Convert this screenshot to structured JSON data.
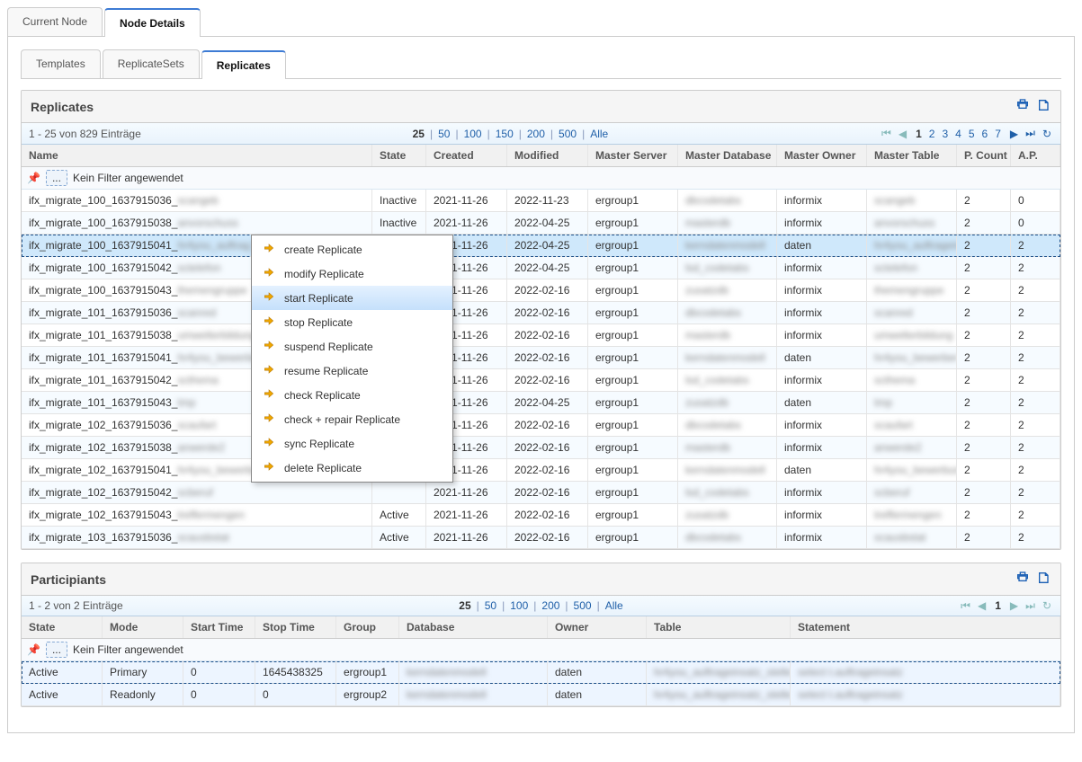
{
  "top_tabs": [
    "Current Node",
    "Node Details"
  ],
  "top_tab_active": 1,
  "inner_tabs": [
    "Templates",
    "ReplicateSets",
    "Replicates"
  ],
  "inner_tab_active": 2,
  "replicates_panel": {
    "title": "Replicates",
    "entries_label": "1 - 25 von 829 Einträge",
    "page_sizes": [
      "25",
      "50",
      "100",
      "150",
      "200",
      "500",
      "Alle"
    ],
    "page_size_current": "25",
    "pages": [
      "1",
      "2",
      "3",
      "4",
      "5",
      "6",
      "7"
    ],
    "page_current": "1",
    "columns": [
      "Name",
      "State",
      "Created",
      "Modified",
      "Master Server",
      "Master Database",
      "Master Owner",
      "Master Table",
      "P. Count",
      "A.P."
    ],
    "filter_label": "Kein Filter angewendet",
    "rows": [
      {
        "name_clear": "ifx_migrate_100_1637915036_",
        "name_blur": "scangeb",
        "state": "Inactive",
        "created": "2021-11-26",
        "modified": "2022-11-23",
        "mserver": "ergroup1",
        "mdb": "dbcodetabs",
        "mowner": "informix",
        "mtable": "scangeb",
        "pcount": "2",
        "ap": "0"
      },
      {
        "name_clear": "ifx_migrate_100_1637915038_",
        "name_blur": "anvorschuss",
        "state": "Inactive",
        "created": "2021-11-26",
        "modified": "2022-04-25",
        "mserver": "ergroup1",
        "mdb": "masterdb",
        "mowner": "informix",
        "mtable": "anvorschuss",
        "pcount": "2",
        "ap": "0"
      },
      {
        "name_clear": "ifx_migrate_100_1637915041_",
        "name_blur": "hr4you_auftrag",
        "state": "",
        "created": "2021-11-26",
        "modified": "2022-04-25",
        "mserver": "ergroup1",
        "mdb": "kerndatenmodell",
        "mowner": "daten",
        "mtable": "hr4you_auftrageins",
        "pcount": "2",
        "ap": "2",
        "selected": true
      },
      {
        "name_clear": "ifx_migrate_100_1637915042_",
        "name_blur": "sctelefon",
        "state": "",
        "created": "2021-11-26",
        "modified": "2022-04-25",
        "mserver": "ergroup1",
        "mdb": "lsd_codetabs",
        "mowner": "informix",
        "mtable": "sctelefon",
        "pcount": "2",
        "ap": "2"
      },
      {
        "name_clear": "ifx_migrate_100_1637915043_",
        "name_blur": "themengruppe",
        "state": "",
        "created": "2021-11-26",
        "modified": "2022-02-16",
        "mserver": "ergroup1",
        "mdb": "zusatzdb",
        "mowner": "informix",
        "mtable": "themengruppe",
        "pcount": "2",
        "ap": "2"
      },
      {
        "name_clear": "ifx_migrate_101_1637915036_",
        "name_blur": "scanred",
        "state": "",
        "created": "2021-11-26",
        "modified": "2022-02-16",
        "mserver": "ergroup1",
        "mdb": "dbcodetabs",
        "mowner": "informix",
        "mtable": "scanred",
        "pcount": "2",
        "ap": "2"
      },
      {
        "name_clear": "ifx_migrate_101_1637915038_",
        "name_blur": "umwelterbildung",
        "state": "",
        "created": "2021-11-26",
        "modified": "2022-02-16",
        "mserver": "ergroup1",
        "mdb": "masterdb",
        "mowner": "informix",
        "mtable": "umwelterbildung",
        "pcount": "2",
        "ap": "2"
      },
      {
        "name_clear": "ifx_migrate_101_1637915041_",
        "name_blur": "hr4you_bewerber",
        "state": "",
        "created": "2021-11-26",
        "modified": "2022-02-16",
        "mserver": "ergroup1",
        "mdb": "kerndatenmodell",
        "mowner": "daten",
        "mtable": "hr4you_bewerber",
        "pcount": "2",
        "ap": "2"
      },
      {
        "name_clear": "ifx_migrate_101_1637915042_",
        "name_blur": "scthema",
        "state": "",
        "created": "2021-11-26",
        "modified": "2022-02-16",
        "mserver": "ergroup1",
        "mdb": "lsd_codetabs",
        "mowner": "informix",
        "mtable": "scthema",
        "pcount": "2",
        "ap": "2"
      },
      {
        "name_clear": "ifx_migrate_101_1637915043_",
        "name_blur": "tmp",
        "state": "",
        "created": "2021-11-26",
        "modified": "2022-04-25",
        "mserver": "ergroup1",
        "mdb": "zusatzdb",
        "mowner": "daten",
        "mtable": "tmp",
        "pcount": "2",
        "ap": "2"
      },
      {
        "name_clear": "ifx_migrate_102_1637915036_",
        "name_blur": "scaufart",
        "state": "",
        "created": "2021-11-26",
        "modified": "2022-02-16",
        "mserver": "ergroup1",
        "mdb": "dbcodetabs",
        "mowner": "informix",
        "mtable": "scaufart",
        "pcount": "2",
        "ap": "2"
      },
      {
        "name_clear": "ifx_migrate_102_1637915038_",
        "name_blur": "anwerde2",
        "state": "",
        "created": "2021-11-26",
        "modified": "2022-02-16",
        "mserver": "ergroup1",
        "mdb": "masterdb",
        "mowner": "informix",
        "mtable": "anwerde2",
        "pcount": "2",
        "ap": "2"
      },
      {
        "name_clear": "ifx_migrate_102_1637915041_",
        "name_blur": "hr4you_bewerbung",
        "state": "",
        "created": "2021-11-26",
        "modified": "2022-02-16",
        "mserver": "ergroup1",
        "mdb": "kerndatenmodell",
        "mowner": "daten",
        "mtable": "hr4you_bewerbung",
        "pcount": "2",
        "ap": "2"
      },
      {
        "name_clear": "ifx_migrate_102_1637915042_",
        "name_blur": "scberuf",
        "state": "",
        "created": "2021-11-26",
        "modified": "2022-02-16",
        "mserver": "ergroup1",
        "mdb": "lsd_codetabs",
        "mowner": "informix",
        "mtable": "scberuf",
        "pcount": "2",
        "ap": "2"
      },
      {
        "name_clear": "ifx_migrate_102_1637915043_",
        "name_blur": "treffermengen",
        "state": "Active",
        "created": "2021-11-26",
        "modified": "2022-02-16",
        "mserver": "ergroup1",
        "mdb": "zusatzdb",
        "mowner": "informix",
        "mtable": "treffermengen",
        "pcount": "2",
        "ap": "2"
      },
      {
        "name_clear": "ifx_migrate_103_1637915036_",
        "name_blur": "scausbstat",
        "state": "Active",
        "created": "2021-11-26",
        "modified": "2022-02-16",
        "mserver": "ergroup1",
        "mdb": "dbcodetabs",
        "mowner": "informix",
        "mtable": "scausbstat",
        "pcount": "2",
        "ap": "2"
      }
    ]
  },
  "context_menu": {
    "items": [
      "create Replicate",
      "modify Replicate",
      "start Replicate",
      "stop Replicate",
      "suspend Replicate",
      "resume Replicate",
      "check Replicate",
      "check + repair Replicate",
      "sync Replicate",
      "delete Replicate"
    ],
    "highlighted": 2
  },
  "participants_panel": {
    "title": "Participiants",
    "entries_label": "1 - 2 von 2 Einträge",
    "page_sizes": [
      "25",
      "50",
      "100",
      "200",
      "500",
      "Alle"
    ],
    "page_size_current": "25",
    "page_current": "1",
    "columns": [
      "State",
      "Mode",
      "Start Time",
      "Stop Time",
      "Group",
      "Database",
      "Owner",
      "Table",
      "Statement"
    ],
    "filter_label": "Kein Filter angewendet",
    "rows": [
      {
        "state": "Active",
        "mode": "Primary",
        "start": "0",
        "stop": "1645438325",
        "group": "ergroup1",
        "db": "kerndatenmodell",
        "owner": "daten",
        "table": "hr4you_auftrageinsatz_stelle",
        "stmt": "select t.auftrageinsatz",
        "selected": true
      },
      {
        "state": "Active",
        "mode": "Readonly",
        "start": "0",
        "stop": "0",
        "group": "ergroup2",
        "db": "kerndatenmodell",
        "owner": "daten",
        "table": "hr4you_auftrageinsatz_stelle",
        "stmt": "select t.auftrageinsatz"
      }
    ]
  }
}
